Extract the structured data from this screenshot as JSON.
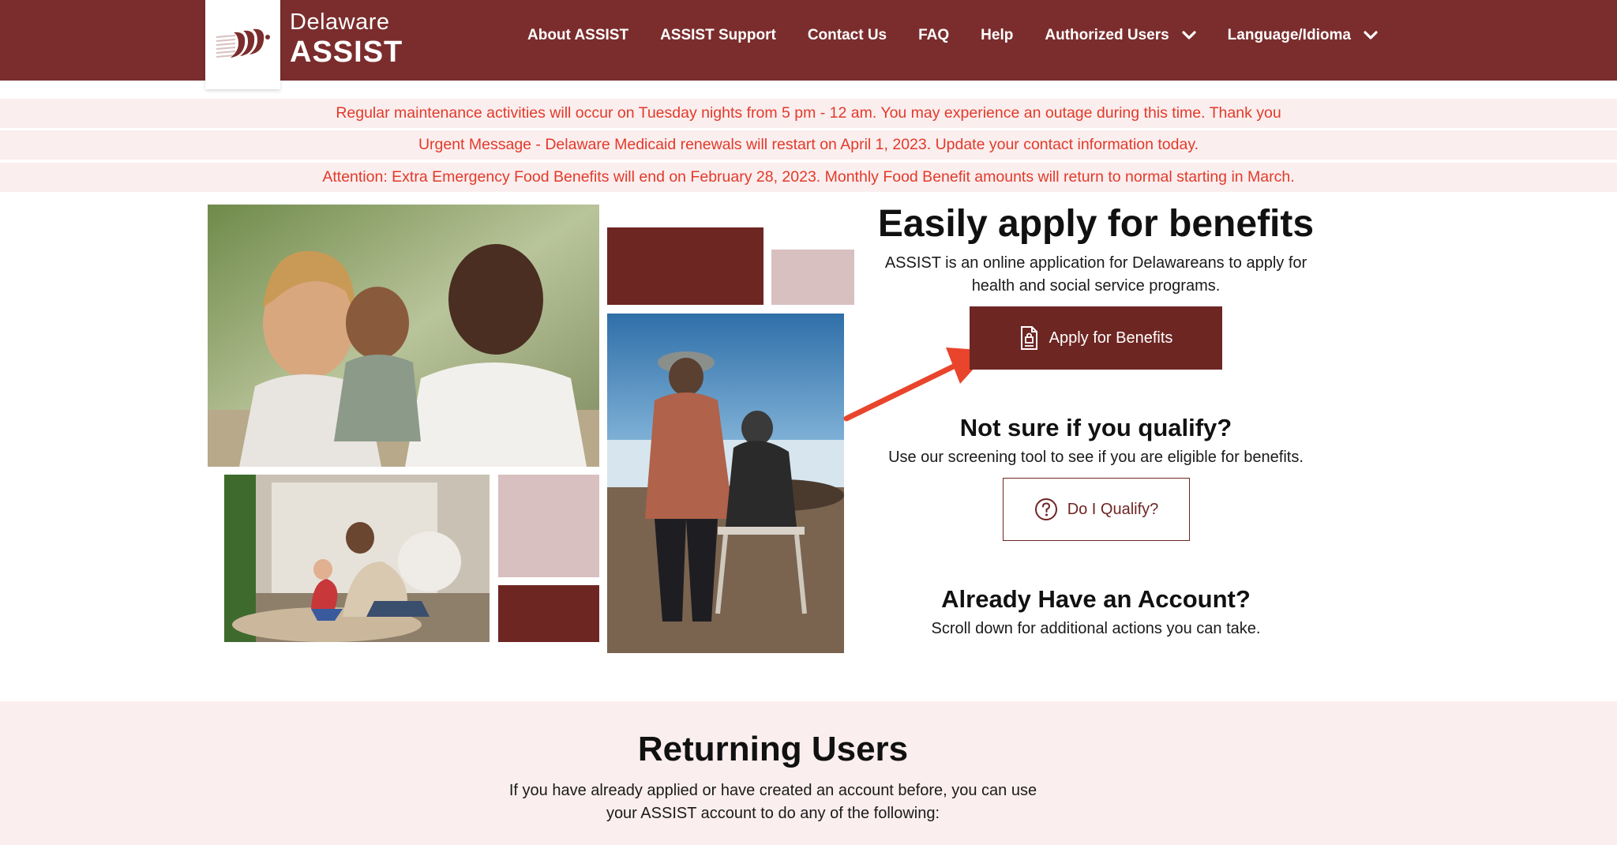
{
  "brand": {
    "line1": "Delaware",
    "line2": "ASSIST",
    "logo_icon": "delaware-assist-logo-icon"
  },
  "nav": {
    "items": [
      {
        "label": "About ASSIST"
      },
      {
        "label": "ASSIST Support"
      },
      {
        "label": "Contact Us"
      },
      {
        "label": "FAQ"
      },
      {
        "label": "Help"
      },
      {
        "label": "Authorized Users",
        "icon": "chevron-down-icon"
      },
      {
        "label": "Language/Idioma",
        "icon": "chevron-down-icon"
      }
    ]
  },
  "alerts": [
    "Regular maintenance activities will occur on Tuesday nights from 5 pm - 12 am. You may experience an outage during this time. Thank you",
    "Urgent Message - Delaware Medicaid renewals will restart on April 1, 2023. Update your contact information today.",
    "Attention: Extra Emergency Food Benefits will end on February 28, 2023. Monthly Food Benefit amounts will return to normal starting in March."
  ],
  "hero": {
    "title": "Easily apply for benefits",
    "description": "ASSIST is an online application for Delawareans to apply for health and social service programs.",
    "apply_button": "Apply for Benefits",
    "apply_icon": "document-lock-icon"
  },
  "qualify": {
    "title": "Not sure if you qualify?",
    "description": "Use our screening tool to see if you are eligible for benefits.",
    "button": "Do I Qualify?",
    "button_icon": "question-circle-icon"
  },
  "account": {
    "title": "Already Have an Account?",
    "description": "Scroll down for additional actions you can take."
  },
  "returning": {
    "title": "Returning Users",
    "description": "If you have already applied or have created an account before, you can use your ASSIST account to do any of the following:"
  },
  "colors": {
    "brand": "#7b2d2d",
    "button_dark": "#6e2623",
    "accent_light": "#d8c0c0",
    "alert_text": "#e23a2a",
    "alert_bg": "#fbeeee",
    "annotation_arrow": "#e8452c"
  }
}
